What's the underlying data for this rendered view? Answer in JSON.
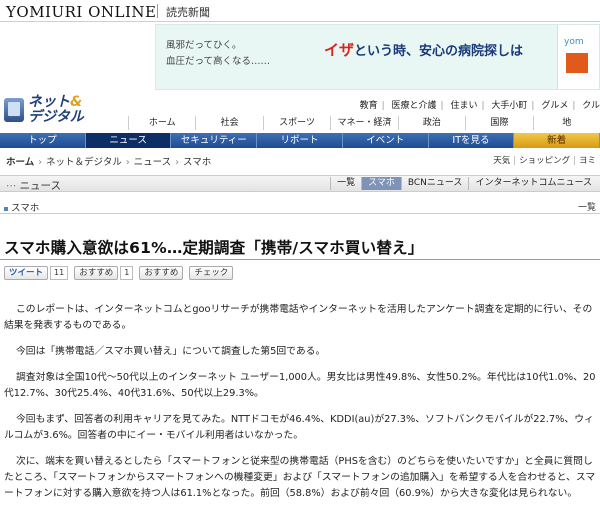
{
  "header": {
    "logo": "YOMIURI ONLINE",
    "logo_sub": "読売新聞"
  },
  "banner": {
    "line1": "風邪だってひく。",
    "line2": "血圧だって高くなる……",
    "main_accent": "イザ",
    "main_rest": "という時、安心の病院探しは",
    "right_text": "yom"
  },
  "section": {
    "title_part1": "ネット",
    "title_amp": "&",
    "title_part2": "デジタル",
    "category_links": [
      "教育",
      "医療と介護",
      "住まい",
      "大手小町",
      "グルメ",
      "クル"
    ],
    "global_nav": [
      "ホーム",
      "社会",
      "スポーツ",
      "マネー・経済",
      "政治",
      "国際",
      "地"
    ]
  },
  "blue_nav": {
    "items": [
      {
        "label": "トップ",
        "state": "normal"
      },
      {
        "label": "ニュース",
        "state": "active"
      },
      {
        "label": "セキュリティー",
        "state": "normal"
      },
      {
        "label": "リポート",
        "state": "normal"
      },
      {
        "label": "イベント",
        "state": "normal"
      },
      {
        "label": "ITを見る",
        "state": "normal"
      },
      {
        "label": "新着",
        "state": "gold"
      }
    ]
  },
  "breadcrumb": {
    "items": [
      "ホーム",
      "ネット＆デジタル",
      "ニュース",
      "スマホ"
    ],
    "util_links": [
      "天気",
      "ショッピング",
      "ヨミ"
    ]
  },
  "news_bar": {
    "title": "ニュース",
    "tabs": [
      {
        "label": "一覧",
        "selected": false
      },
      {
        "label": "スマホ",
        "selected": true
      },
      {
        "label": "BCNニュース",
        "selected": false
      },
      {
        "label": "インターネットコムニュース",
        "selected": false
      }
    ]
  },
  "sub_bar": {
    "title": "スマホ",
    "list_link": "一覧"
  },
  "article": {
    "headline": "スマホ購入意欲は61%…定期調査「携帯/スマホ買い替え」",
    "social": {
      "tweet": "ツイート",
      "tweet_count": "11",
      "recommend": "おすすめ",
      "recommend_count": "1",
      "recommend2": "おすすめ",
      "check": "チェック"
    },
    "paragraphs": [
      "このレポートは、インターネットコムとgooリサーチが携帯電話やインターネットを活用したアンケート調査を定期的に行い、その結果を発表するものである。",
      "今回は「携帯電話／スマホ買い替え」について調査した第5回である。",
      "調査対象は全国10代～50代以上のインターネット ユーザー1,000人。男女比は男性49.8%、女性50.2%。年代比は10代1.0%、20代12.7%、30代25.4%、40代31.6%、50代以上29.3%。",
      "今回もまず、回答者の利用キャリアを見てみた。NTTドコモが46.4%、KDDI(au)が27.3%、ソフトバンクモバイルが22.7%、ウィルコムが3.6%。回答者の中にイー・モバイル利用者はいなかった。",
      "次に、端末を買い替えるとしたら「スマートフォンと従来型の携帯電話（PHSを含む）のどちらを使いたいですか」と全員に質問したところ、「スマートフォンからスマートフォンへの機種変更」および「スマートフォンの追加購入」を希望する人を合わせると、スマートフォンに対する購入意欲を持つ人は61.1%となった。前回（58.8%）および前々回（60.9%）から大きな変化は見られない。"
    ]
  }
}
